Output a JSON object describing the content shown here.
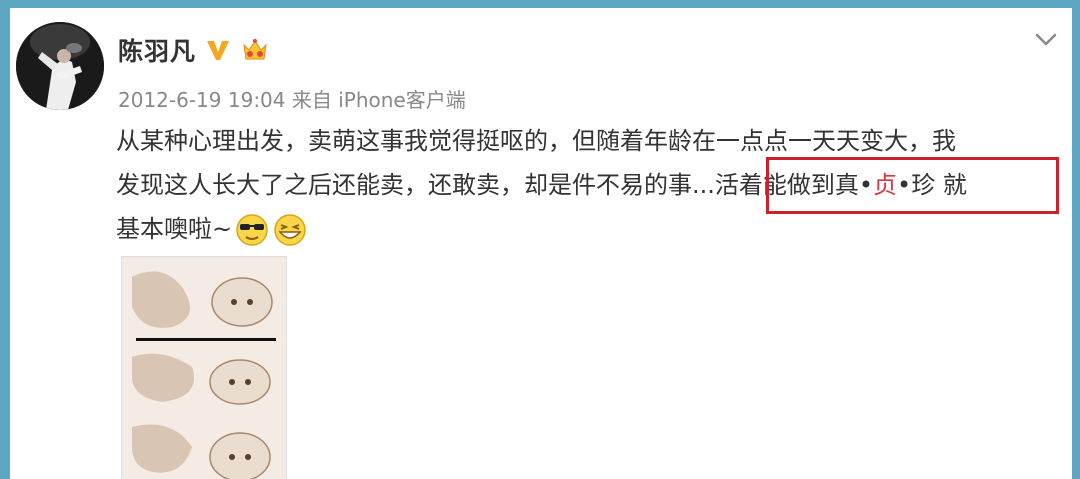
{
  "user": {
    "name": "陈羽凡",
    "verified_icon": "verified-v-icon",
    "member_icon": "crown-member-icon"
  },
  "post": {
    "timestamp": "2012-6-19 19:04",
    "source": "来自 iPhone客户端",
    "lines": [
      "从某种心理出发，卖萌这事我觉得挺呕的，但随着年龄在一点点一天天变大，我",
      "发现这人长大了之后还能卖，还敢卖，却是件不易的事...",
      "基本噢啦~"
    ],
    "highlight": {
      "part1": "活着能做到真•",
      "part2": "贞",
      "part3": "•珍 就"
    },
    "emojis": [
      "sunglasses-emoji",
      "laughing-emoji"
    ]
  },
  "colors": {
    "frame": "#5da7c2",
    "highlight_border": "#c9222b",
    "highlight_text": "#d9363e",
    "badge_v": "#f5a623"
  }
}
